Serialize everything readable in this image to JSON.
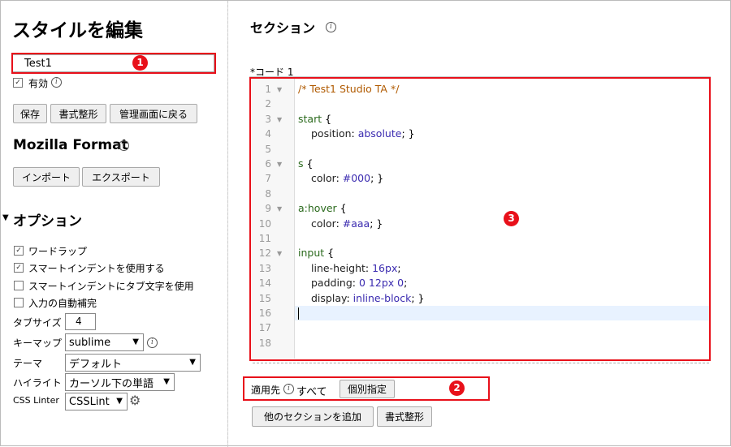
{
  "left": {
    "title": "スタイルを編集",
    "name_value": "Test1",
    "enabled_label": "有効",
    "buttons": {
      "save": "保存",
      "beautify": "書式整形",
      "back": "管理画面に戻る"
    },
    "mozilla_title": "Mozilla Format",
    "import": "インポート",
    "export": "エクスポート",
    "options_title": "オプション",
    "options": [
      {
        "label": "ワードラップ",
        "checked": true
      },
      {
        "label": "スマートインデントを使用する",
        "checked": true
      },
      {
        "label": "スマートインデントにタブ文字を使用",
        "checked": false
      },
      {
        "label": "入力の自動補完",
        "checked": false
      }
    ],
    "tab_size_label": "タブサイズ",
    "tab_size_value": "4",
    "keymap_label": "キーマップ",
    "keymap_value": "sublime",
    "theme_label": "テーマ",
    "theme_value": "デフォルト",
    "highlight_label": "ハイライト",
    "highlight_value": "カーソル下の単語",
    "linter_label": "CSS Linter",
    "linter_value": "CSSLint"
  },
  "right": {
    "section_title": "セクション",
    "code_label": "*コード 1",
    "line_numbers": [
      "1",
      "2",
      "3",
      "4",
      "5",
      "6",
      "7",
      "8",
      "9",
      "10",
      "11",
      "12",
      "13",
      "14",
      "15",
      "16",
      "17",
      "18"
    ],
    "code": {
      "l1": "/* Test1 Studio TA */",
      "l3_sel": "start",
      "l4_prop": "position",
      "l4_val": "absolute",
      "l6_sel": "s",
      "l7_prop": "color",
      "l7_val": "#000",
      "l9_sel": "a:hover",
      "l10_prop": "color",
      "l10_val": "#aaa",
      "l12_sel": "input",
      "l13_prop": "line-height",
      "l13_val": "16px",
      "l14_prop": "padding",
      "l14_val": "0 12px 0",
      "l15_prop": "display",
      "l15_val": "inline-block"
    },
    "applies_label": "適用先",
    "applies_value": "すべて",
    "specify_button": "個別指定",
    "add_section_button": "他のセクションを追加",
    "beautify_button": "書式整形"
  },
  "badges": {
    "b1": "1",
    "b2": "2",
    "b3": "3"
  },
  "colors": {
    "highlight": "#e8101a",
    "active_line": "#e8f2ff"
  }
}
